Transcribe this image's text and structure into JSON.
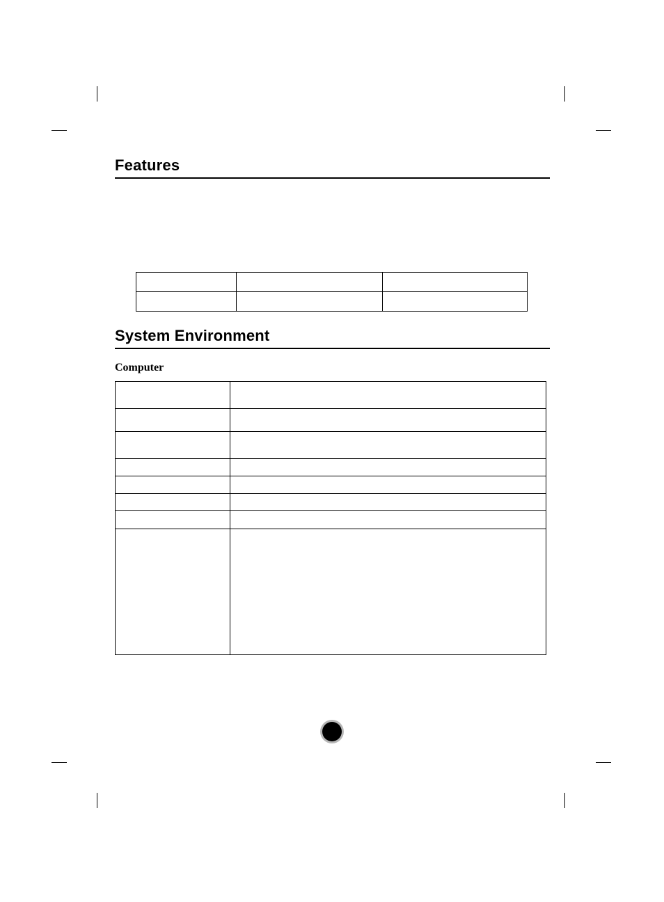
{
  "headings": {
    "features": "Features",
    "system_environment": "System Environment"
  },
  "subheadings": {
    "computer": "Computer"
  }
}
